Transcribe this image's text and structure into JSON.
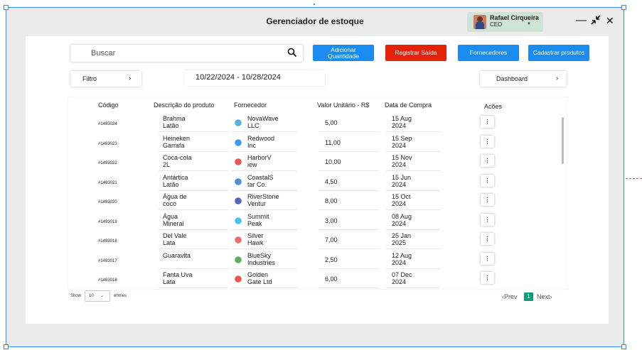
{
  "app": {
    "title": "Gerenciador de estoque"
  },
  "profile": {
    "name": "Rafael Cirqueira",
    "role": "CEO"
  },
  "window": {
    "minimize": "—",
    "restore": "⤡",
    "close": "✕"
  },
  "search": {
    "placeholder": "Buscar"
  },
  "actions": {
    "add_quantity": "Adicionar Quantidade",
    "register_exit": "Registrar Saída",
    "suppliers": "Fornecedores",
    "register_products": "Cadastrar produtos"
  },
  "filter": {
    "label": "Filtro"
  },
  "date_range": "10/22/2024 - 10/28/2024",
  "dashboard": {
    "label": "Dashboard"
  },
  "table": {
    "headers": {
      "code": "Código",
      "description": "Descrição do produto",
      "supplier": "Fornecedor",
      "unit_value": "Valor Unitário  - R$",
      "purchase_date": "Data de Compra",
      "actions": "Acões"
    },
    "rows": [
      {
        "code": "#1493024",
        "desc1": "Brahma",
        "desc2": "Latão",
        "sup1": "NovaWave",
        "sup2": "LLC",
        "value": "5,00",
        "date1": "15 Aug",
        "date2": "2024",
        "icon_color": "#3aa0d8"
      },
      {
        "code": "#1493023",
        "desc1": "Heineken",
        "desc2": "Garrafa",
        "sup1": "Redwood",
        "sup2": "Inc",
        "value": "11,00",
        "date1": "15 Sep",
        "date2": "2024",
        "icon_color": "#1e88e5"
      },
      {
        "code": "#1493022",
        "desc1": "Coca-cola",
        "desc2": "2L",
        "sup1": "HarborV",
        "sup2": "iew",
        "value": "10,00",
        "date1": "15 Nov",
        "date2": "2024",
        "icon_color": "#e53935"
      },
      {
        "code": "#1493021",
        "desc1": "Antártica",
        "desc2": "Latão",
        "sup1": "CoastalS",
        "sup2": "tar Co.",
        "value": "4,50",
        "date1": "15 Jun",
        "date2": "2024",
        "icon_color": "#2e7bd6"
      },
      {
        "code": "#1493020",
        "desc1": "Água de",
        "desc2": "coco",
        "sup1": "RiverStone",
        "sup2": "Ventur",
        "value": "8,00",
        "date1": "15 Oct",
        "date2": "2024",
        "icon_color": "#3949ab"
      },
      {
        "code": "#1493019",
        "desc1": "Água",
        "desc2": "Mineral",
        "sup1": "Summit",
        "sup2": "Peak",
        "value": "3,00",
        "date1": "08 Aug",
        "date2": "2024",
        "icon_color": "#29b6f6"
      },
      {
        "code": "#1493018",
        "desc1": "Del Vale",
        "desc2": "Lata",
        "sup1": "Silver",
        "sup2": "Hawk",
        "value": "7,00",
        "date1": "25 Jan",
        "date2": "2025",
        "icon_color": "#ef5350"
      },
      {
        "code": "#1493017",
        "desc1": "Guaravita",
        "desc2": "",
        "sup1": "BlueSky",
        "sup2": "Industries",
        "value": "2,50",
        "date1": "12 Aug",
        "date2": "2024",
        "icon_color": "#43a047"
      },
      {
        "code": "#1493018",
        "desc1": "Fanta Uva",
        "desc2": "Lata",
        "sup1": "Golden",
        "sup2": "Gate Ltd",
        "value": "6,00",
        "date1": "07 Dec",
        "date2": "2024",
        "icon_color": "#e53935"
      }
    ]
  },
  "pagination": {
    "show": "Show",
    "page_size": "10",
    "entries": "entries",
    "prev": "‹Prev",
    "current": "1",
    "next": "Next›"
  }
}
